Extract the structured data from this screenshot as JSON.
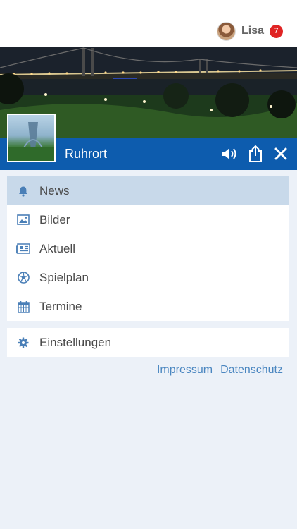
{
  "user": {
    "name": "Lisa",
    "notification_count": "7"
  },
  "header": {
    "title": "Ruhrort"
  },
  "menu": {
    "items": [
      {
        "label": "News",
        "icon": "bell-icon",
        "active": true
      },
      {
        "label": "Bilder",
        "icon": "image-icon"
      },
      {
        "label": "Aktuell",
        "icon": "newspaper-icon"
      },
      {
        "label": "Spielplan",
        "icon": "soccer-ball-icon"
      },
      {
        "label": "Termine",
        "icon": "calendar-icon"
      }
    ],
    "settings": {
      "label": "Einstellungen",
      "icon": "gear-icon"
    }
  },
  "footer": {
    "impressum": "Impressum",
    "datenschutz": "Datenschutz"
  },
  "colors": {
    "primary": "#0d5cae",
    "active_bg": "#c8d9ea",
    "link": "#4a86c0",
    "badge": "#e02424"
  }
}
